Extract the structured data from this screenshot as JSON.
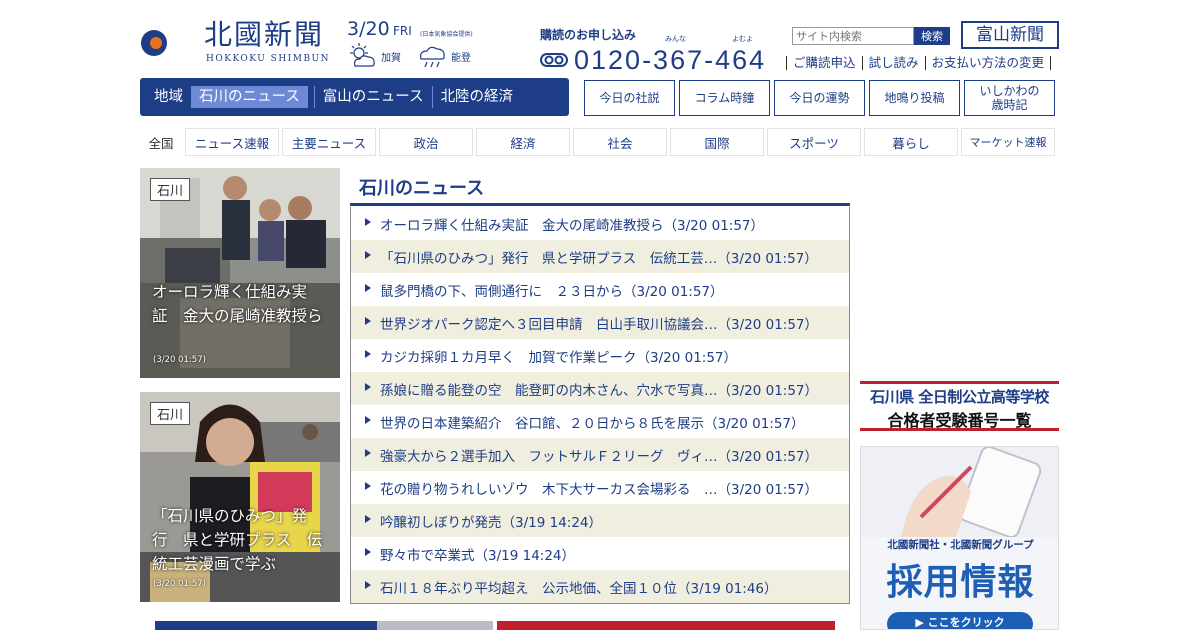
{
  "logo": {
    "title": "北國新聞",
    "subtitle": "HOKKOKU SHIMBUN"
  },
  "date": {
    "day": "3/20",
    "weekday": "FRI",
    "source": "(日本気象協会提供)"
  },
  "weather": [
    {
      "area": "加賀",
      "icon": "sunny-cloudy-icon"
    },
    {
      "area": "能登",
      "icon": "cloudy-rain-icon"
    }
  ],
  "subscribe": {
    "label": "購読のお申し込み",
    "ruby_left": "みんな",
    "ruby_right": "よむよ",
    "phone": "0120-367-464"
  },
  "search": {
    "placeholder": "サイト内検索",
    "button": "検索"
  },
  "toyama_link": "富山新聞",
  "top_links": [
    "ご購読申込",
    "試し読み",
    "お支払い方法の変更"
  ],
  "region_nav": {
    "label": "地域",
    "items": [
      "石川のニュース",
      "富山のニュース",
      "北陸の経済"
    ],
    "active": 0
  },
  "feature_buttons": [
    "今日の社説",
    "コラム時鐘",
    "今日の運勢",
    "地鳴り投稿",
    "いしかわの\n歳時記"
  ],
  "categories": {
    "all": "全国",
    "items": [
      "ニュース速報",
      "主要ニュース",
      "政治",
      "経済",
      "社会",
      "国際",
      "スポーツ",
      "暮らし",
      "マーケット速報"
    ]
  },
  "photo_cards": [
    {
      "tag": "石川",
      "caption_lines": [
        "オーロラ輝く仕組み実",
        "証　金大の尾崎准教授ら"
      ],
      "time": "(3/20 01:57)"
    },
    {
      "tag": "石川",
      "caption_lines": [
        "「石川県のひみつ」発",
        "行　県と学研プラス　伝",
        "統工芸漫画で学ぶ"
      ],
      "time": "(3/20 01:57)"
    }
  ],
  "news_section": {
    "title": "石川のニュース",
    "items": [
      "オーロラ輝く仕組み実証　金大の尾崎准教授ら（3/20 01:57）",
      "「石川県のひみつ」発行　県と学研プラス　伝統工芸…（3/20 01:57）",
      "鼠多門橋の下、両側通行に　２３日から（3/20 01:57）",
      "世界ジオパーク認定へ３回目申請　白山手取川協議会…（3/20 01:57）",
      "カジカ採卵１カ月早く　加賀で作業ピーク（3/20 01:57）",
      "孫娘に贈る能登の空　能登町の内木さん、穴水で写真…（3/20 01:57）",
      "世界の日本建築紹介　谷口館、２０日から８氏を展示（3/20 01:57）",
      "強豪大から２選手加入　フットサルＦ２リーグ　ヴィ…（3/20 01:57）",
      "花の贈り物うれしいゾウ　木下大サーカス会場彩る　…（3/20 01:57）",
      "吟醸初しぼりが発売（3/19 14:24）",
      "野々市で卒業式（3/19 14:24）",
      "石川１８年ぶり平均超え　公示地価、全国１０位（3/19 01:46）"
    ]
  },
  "ads": {
    "exam": {
      "line1": "石川県 全日制公立高等学校",
      "line2": "合格者受験番号一覧"
    },
    "recruit": {
      "line1": "北國新聞社・北國新聞グループ",
      "line2": "採用情報",
      "button": "▶ ここをクリック"
    }
  },
  "colors": {
    "brand": "#1d3d86",
    "active_tab": "#6d8ad6",
    "stripe": "#f0efdf",
    "ad_red": "#c01f2c"
  }
}
